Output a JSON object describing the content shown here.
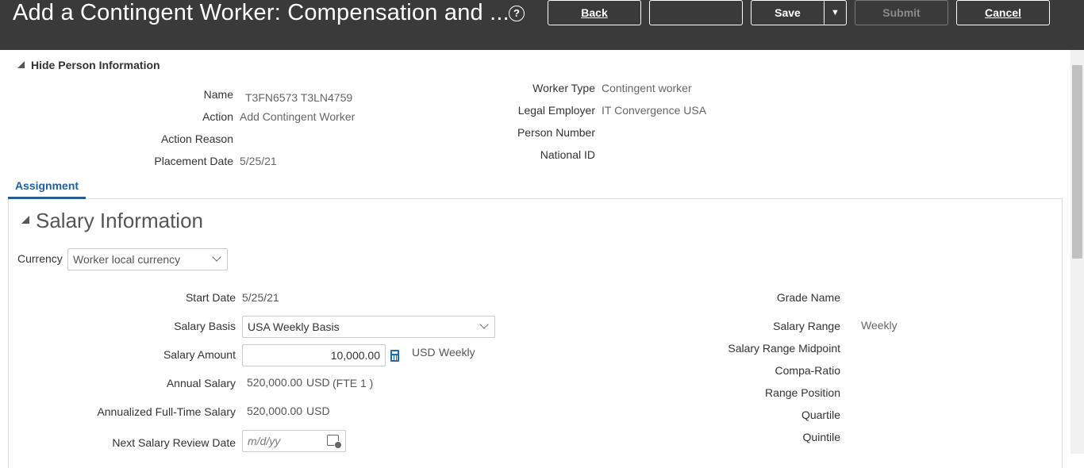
{
  "header": {
    "title": "Add a Contingent Worker: Compensation and ...",
    "help_icon": "?",
    "buttons": {
      "back": "Back",
      "blank": "",
      "save": "Save",
      "save_menu": "▼",
      "submit": "Submit",
      "cancel": "Cancel"
    }
  },
  "person_info": {
    "toggle_label": "Hide Person Information",
    "name_label": "Name",
    "name_value": "T3FN6573 T3LN4759",
    "action_label": "Action",
    "action_value": "Add Contingent Worker",
    "action_reason_label": "Action Reason",
    "placement_date_label": "Placement Date",
    "placement_date_value": "5/25/21",
    "worker_type_label": "Worker Type",
    "worker_type_value": "Contingent worker",
    "legal_employer_label": "Legal Employer",
    "legal_employer_value": "IT Convergence USA",
    "person_number_label": "Person Number",
    "national_id_label": "National ID"
  },
  "tabs": [
    {
      "label": "Assignment",
      "active": true
    }
  ],
  "salary": {
    "section_title": "Salary Information",
    "currency_label": "Currency",
    "currency_value": "Worker local currency",
    "start_date_label": "Start Date",
    "start_date_value": "5/25/21",
    "salary_basis_label": "Salary Basis",
    "salary_basis_value": "USA Weekly Basis",
    "salary_amount_label": "Salary Amount",
    "salary_amount_value": "10,000.00",
    "salary_amount_currency": "USD",
    "salary_amount_freq": "Weekly",
    "annual_salary_label": "Annual Salary",
    "annual_salary_value": "520,000.00",
    "annual_salary_currency": "USD",
    "annual_salary_fte": "(FTE 1 )",
    "annualized_ft_label": "Annualized Full-Time Salary",
    "annualized_ft_value": "520,000.00",
    "annualized_ft_currency": "USD",
    "next_review_label": "Next Salary Review Date",
    "next_review_placeholder": "m/d/yy",
    "grade_name_label": "Grade Name",
    "salary_range_label": "Salary Range",
    "salary_range_value": "Weekly",
    "range_midpoint_label": "Salary Range Midpoint",
    "compa_ratio_label": "Compa-Ratio",
    "range_position_label": "Range Position",
    "quartile_label": "Quartile",
    "quintile_label": "Quintile"
  },
  "colors": {
    "header_bg": "#3a3a3a",
    "tab_accent": "#1f5f9c",
    "calculator_icon": "#1a6db5"
  },
  "icons": [
    "help-icon",
    "calculator-icon",
    "calendar-icon",
    "chevron-down-icon",
    "disclosure-triangle-icon"
  ]
}
